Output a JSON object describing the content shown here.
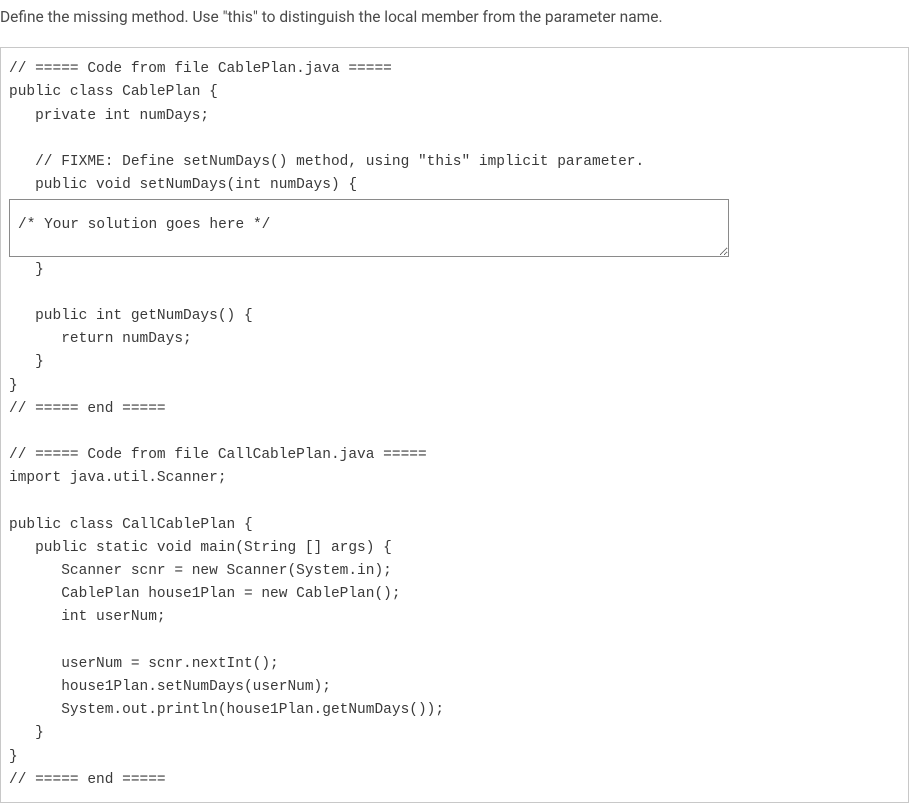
{
  "instruction": "Define the missing method. Use \"this\" to distinguish the local member from the parameter name.",
  "code": {
    "before": [
      "// ===== Code from file CablePlan.java =====",
      "public class CablePlan {",
      "   private int numDays;",
      "",
      "   // FIXME: Define setNumDays() method, using \"this\" implicit parameter.",
      "   public void setNumDays(int numDays) {"
    ],
    "solution_placeholder": "      /* Your solution goes here  */",
    "after": [
      "   }",
      "",
      "   public int getNumDays() {",
      "      return numDays;",
      "   }",
      "}",
      "// ===== end =====",
      "",
      "// ===== Code from file CallCablePlan.java =====",
      "import java.util.Scanner;",
      "",
      "public class CallCablePlan {",
      "   public static void main(String [] args) {",
      "      Scanner scnr = new Scanner(System.in);",
      "      CablePlan house1Plan = new CablePlan();",
      "      int userNum;",
      "",
      "      userNum = scnr.nextInt();",
      "      house1Plan.setNumDays(userNum);",
      "      System.out.println(house1Plan.getNumDays());",
      "   }",
      "}",
      "// ===== end ====="
    ]
  }
}
